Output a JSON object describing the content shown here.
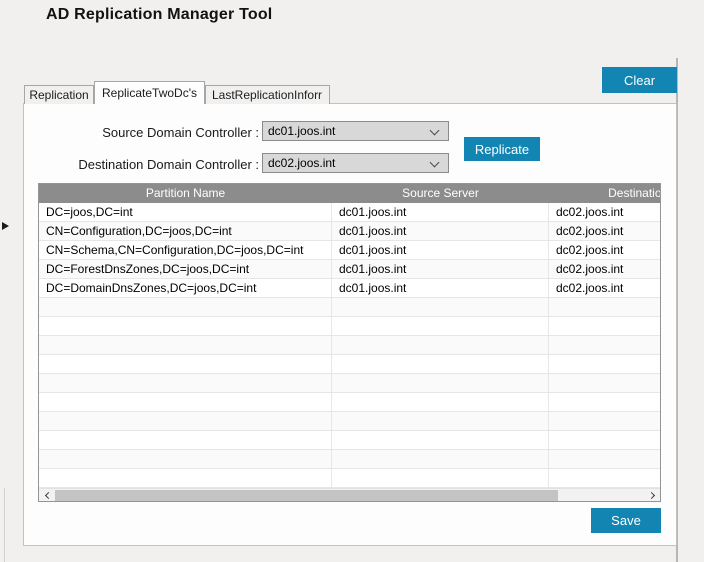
{
  "title": "AD Replication Manager Tool",
  "tabs": {
    "replication": "Replication",
    "replicate_two_dcs": "ReplicateTwoDc's",
    "last_replication_info": "LastReplicationInforr"
  },
  "buttons": {
    "clear_label": "Clear",
    "replicate_label": "Replicate",
    "save_label": "Save"
  },
  "form": {
    "source_label": "Source Domain Controller :",
    "source_value": "dc01.joos.int",
    "destination_label": "Destination Domain Controller :",
    "destination_value": "dc02.joos.int"
  },
  "grid": {
    "columns": [
      "Partition Name",
      "Source Server",
      "Destination Server"
    ],
    "rows": [
      {
        "partition": "DC=joos,DC=int",
        "source": "dc01.joos.int",
        "destination": "dc02.joos.int"
      },
      {
        "partition": "CN=Configuration,DC=joos,DC=int",
        "source": "dc01.joos.int",
        "destination": "dc02.joos.int"
      },
      {
        "partition": "CN=Schema,CN=Configuration,DC=joos,DC=int",
        "source": "dc01.joos.int",
        "destination": "dc02.joos.int"
      },
      {
        "partition": "DC=ForestDnsZones,DC=joos,DC=int",
        "source": "dc01.joos.int",
        "destination": "dc02.joos.int"
      },
      {
        "partition": "DC=DomainDnsZones,DC=joos,DC=int",
        "source": "dc01.joos.int",
        "destination": "dc02.joos.int"
      }
    ],
    "empty_row_count": 10
  },
  "colors": {
    "accent": "#1285b2",
    "grid_header_bg": "#8c8c8c",
    "combo_bg": "#d8d8d8"
  }
}
